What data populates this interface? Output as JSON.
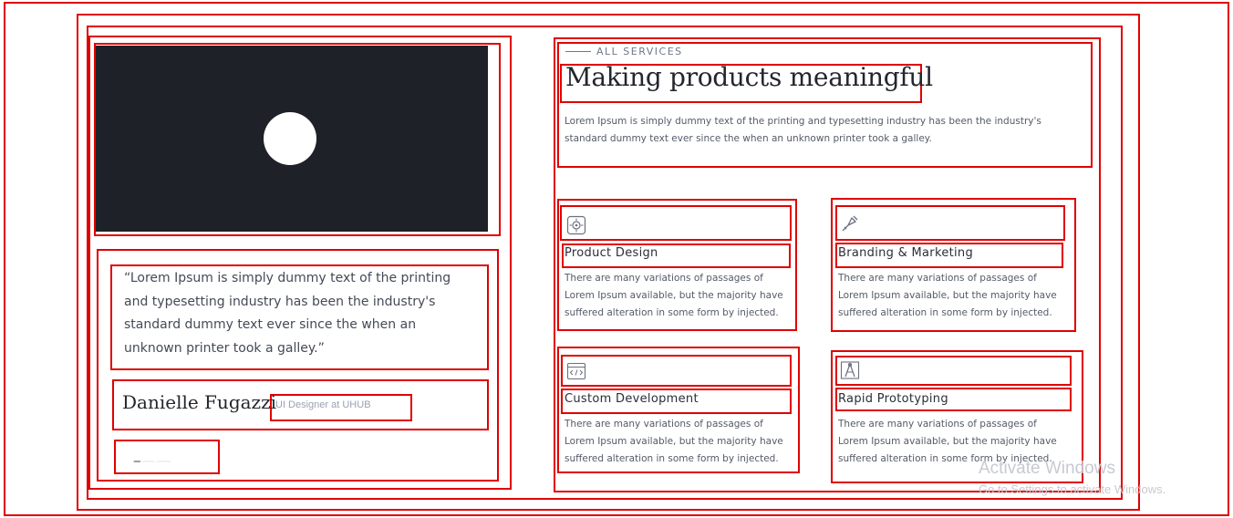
{
  "testimonial": {
    "quote": "“Lorem Ipsum is simply dummy text of the printing and typesetting industry  has been the industry's standard dummy text ever since the when an unknown printer took a galley.”",
    "author": "Danielle Fugazzi",
    "role": "UI Designer at UHUB"
  },
  "services": {
    "eyebrow": "ALL SERVICES",
    "heading": "Making products meaningful",
    "intro": "Lorem Ipsum is simply dummy text of the printing and typesetting industry  has been the industry's standard dummy text ever since the when an unknown printer took a galley.",
    "items": [
      {
        "title": "Product Design",
        "desc": "There are many variations of passages of Lorem Ipsum available, but the majority have suffered alteration in some form by injected.",
        "icon": "product-design-icon"
      },
      {
        "title": "Branding & Marketing",
        "desc": "There are many variations of passages of Lorem Ipsum available, but the majority have suffered alteration in some form by injected.",
        "icon": "branding-icon"
      },
      {
        "title": "Custom Development",
        "desc": "There are many variations of passages of Lorem Ipsum available, but the majority have suffered alteration in some form by injected.",
        "icon": "code-icon"
      },
      {
        "title": "Rapid Prototyping",
        "desc": "There are many variations of passages of Lorem Ipsum available, but the majority have suffered alteration in some form by injected.",
        "icon": "prototyping-icon"
      }
    ]
  },
  "watermark": {
    "line1": "Activate Windows",
    "line2": "Go to Settings to activate Windows."
  },
  "colors": {
    "outline": "#e00000",
    "video_bg": "#1e2127",
    "text_dark": "#23262d",
    "text_body": "#545a68"
  }
}
